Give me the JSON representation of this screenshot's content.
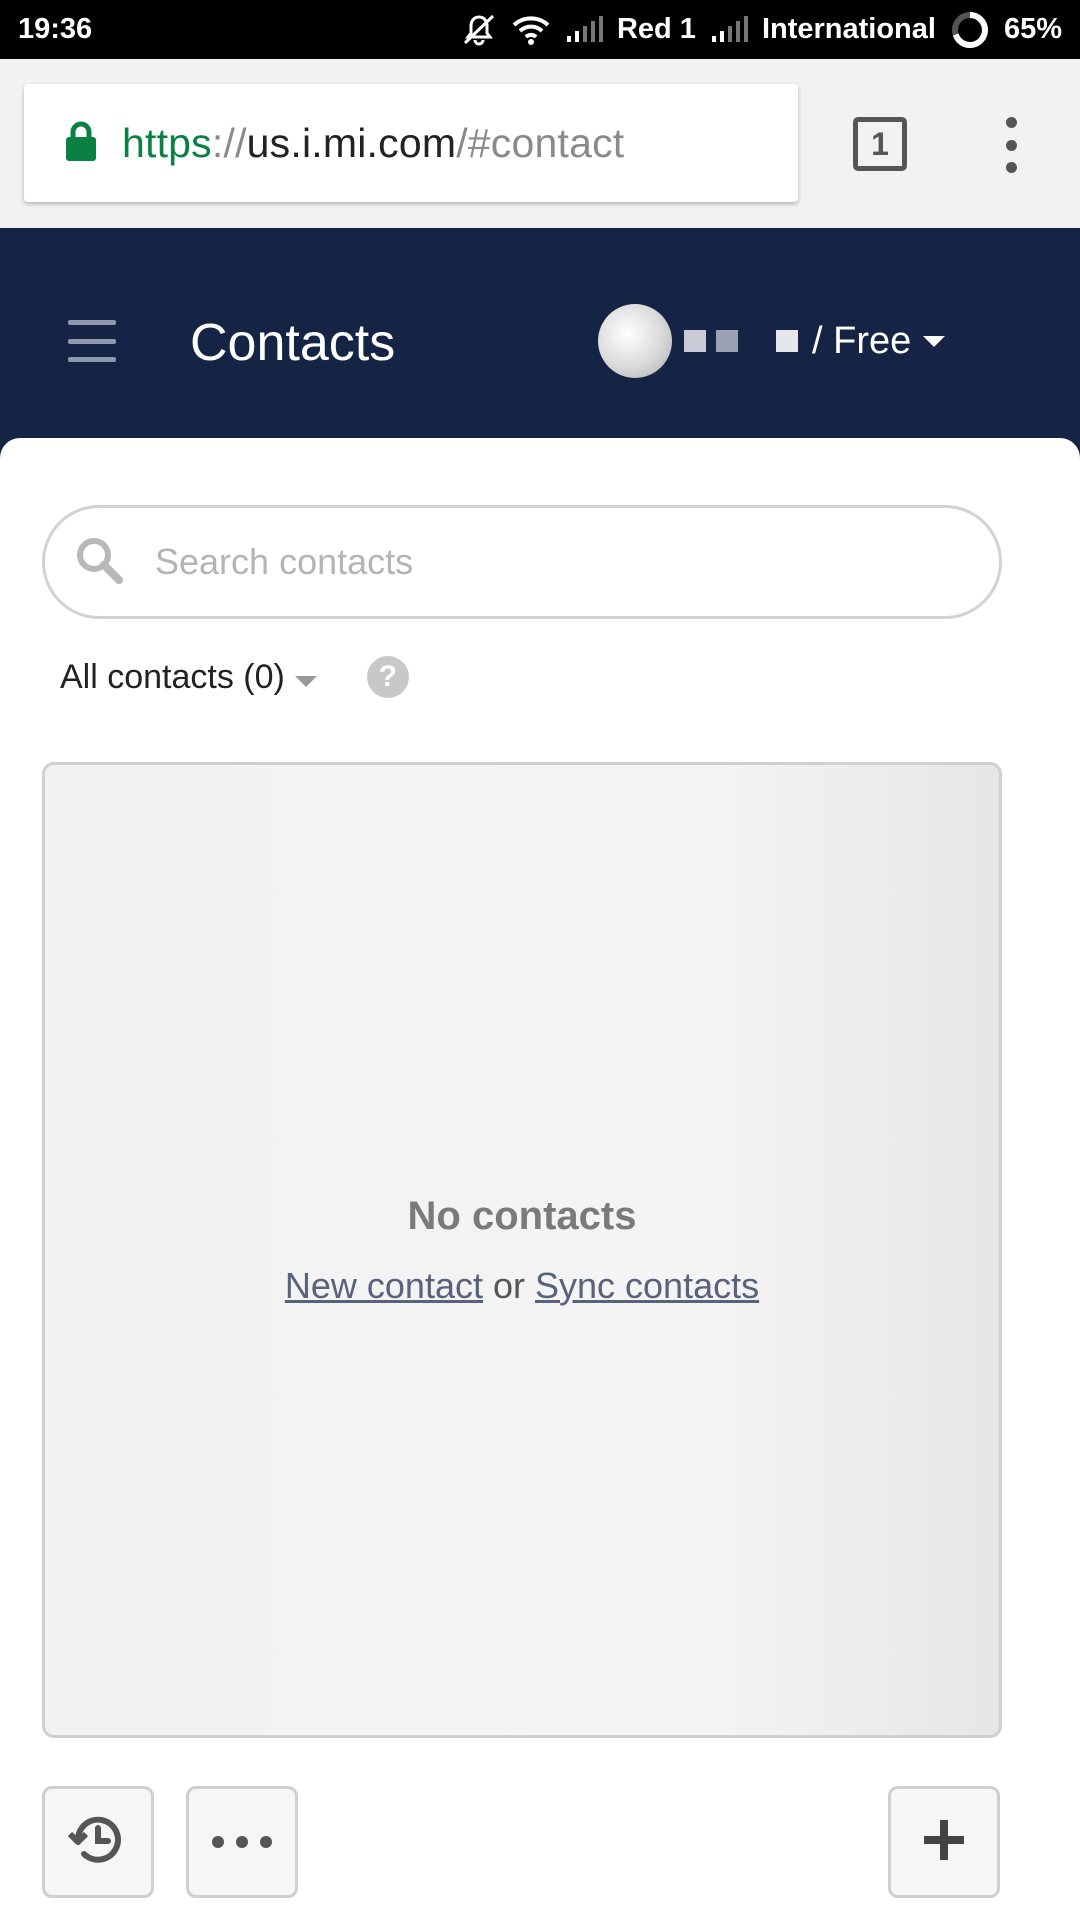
{
  "status_bar": {
    "time": "19:36",
    "carrier1": "Red 1",
    "carrier2": "International",
    "battery": "65%"
  },
  "browser": {
    "url_scheme": "https",
    "url_sep": "://",
    "url_host": "us.i.mi.com",
    "url_path": "/#contact",
    "tab_count": "1"
  },
  "header": {
    "title": "Contacts",
    "plan": "/ Free"
  },
  "search": {
    "placeholder": "Search contacts"
  },
  "filter": {
    "label": "All contacts (0)",
    "help": "?"
  },
  "empty_state": {
    "title": "No contacts",
    "new_contact": "New contact",
    "or": "or",
    "sync_contacts": "Sync contacts"
  },
  "colors": {
    "header_bg": "#152445",
    "url_scheme": "#0b8043",
    "link": "#56637a"
  },
  "icons": [
    "mute-icon",
    "wifi-icon",
    "signal-icon",
    "battery-icon",
    "lock-icon",
    "tabs-icon",
    "more-vert-icon",
    "hamburger-icon",
    "avatar",
    "search-icon",
    "help-icon",
    "history-icon",
    "more-horiz-icon",
    "plus-icon"
  ]
}
